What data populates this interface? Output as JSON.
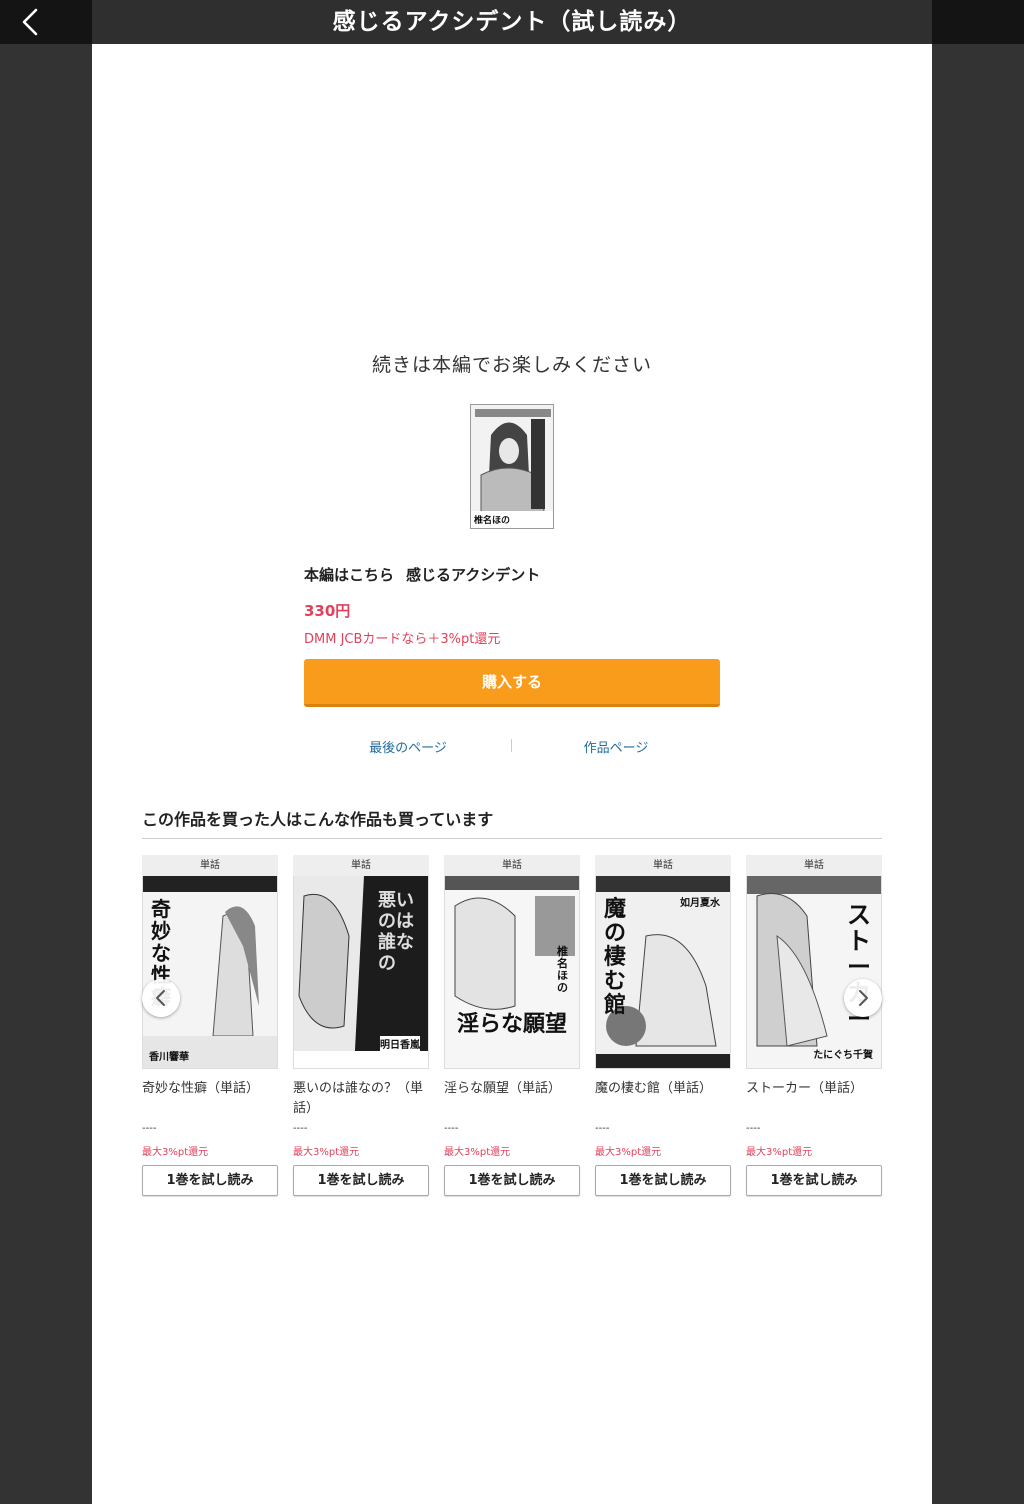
{
  "header": {
    "title": "感じるアクシデント（試し読み）"
  },
  "main": {
    "continue_text": "続きは本編でお楽しみください",
    "product_prefix": "本編はこちら",
    "product_title": "感じるアクシデント",
    "price": "330円",
    "jcb_note": "DMM JCBカードなら＋3%pt還元",
    "buy_label": "購入する",
    "cover_author": "椎名ほの",
    "links": {
      "last_page": "最後のページ",
      "work_page": "作品ページ"
    }
  },
  "recommendations": {
    "heading": "この作品を買った人はこんな作品も買っています",
    "items": [
      {
        "tag": "単話",
        "title": "奇妙な性癖（単話）",
        "price": "----",
        "pt": "最大3%pt還元",
        "trial": "1巻を試し読み",
        "cover_text": "奇妙な性癖",
        "cover_author": "香川響華"
      },
      {
        "tag": "単話",
        "title": "悪いのは誰なの？（単話）",
        "price": "----",
        "pt": "最大3%pt還元",
        "trial": "1巻を試し読み",
        "cover_text": "悪いのは誰なの",
        "cover_author": "明日香嵐"
      },
      {
        "tag": "単話",
        "title": "淫らな願望（単話）",
        "price": "----",
        "pt": "最大3%pt還元",
        "trial": "1巻を試し読み",
        "cover_text": "淫らな願望",
        "cover_author": "椎名ほの"
      },
      {
        "tag": "単話",
        "title": "魔の棲む館（単話）",
        "price": "----",
        "pt": "最大3%pt還元",
        "trial": "1巻を試し読み",
        "cover_text": "魔の棲む館",
        "cover_author": "如月夏水"
      },
      {
        "tag": "単話",
        "title": "ストーカー（単話）",
        "price": "----",
        "pt": "最大3%pt還元",
        "trial": "1巻を試し読み",
        "cover_text": "ストーカー",
        "cover_author": "たにぐち千賀"
      }
    ]
  },
  "colors": {
    "accent_orange": "#f99c1b",
    "price_pink": "#e0425b",
    "link_blue": "#1f6d9d"
  },
  "icons": {
    "back": "chevron-left-icon",
    "prev": "chevron-left-icon",
    "next": "chevron-right-icon"
  }
}
